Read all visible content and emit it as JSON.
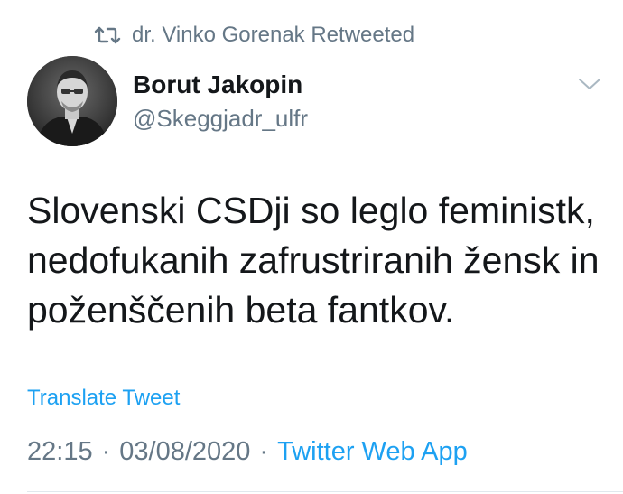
{
  "retweet": {
    "label": "dr. Vinko Gorenak Retweeted",
    "icon": "retweet-icon"
  },
  "author": {
    "display_name": "Borut Jakopin",
    "handle": "@Skeggjadr_ulfr",
    "avatar": "avatar-photo"
  },
  "tweet": {
    "text": "Slovenski CSDji so leglo feministk,\nnedofukanih zafrustriranih žensk in\npoženščenih beta fantkov.",
    "translate_label": "Translate Tweet",
    "time": "22:15",
    "separator": "·",
    "date": "03/08/2020",
    "source": "Twitter Web App"
  },
  "colors": {
    "link_blue": "#1da1f2",
    "secondary_gray": "#657786",
    "text_dark": "#14171a",
    "divider": "#e1e8ed"
  }
}
